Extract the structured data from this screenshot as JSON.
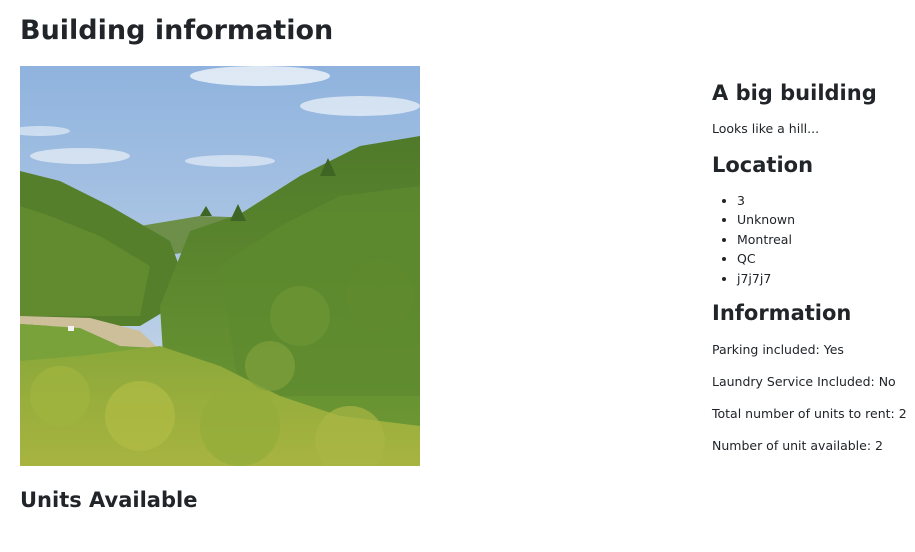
{
  "page": {
    "title": "Building information"
  },
  "photo": {
    "subject": "green forested hillside valley under a light blue sky"
  },
  "building": {
    "name": "A big building",
    "description": "Looks like a hill..."
  },
  "location": {
    "heading": "Location",
    "items": [
      "3",
      "Unknown",
      "Montreal",
      "QC",
      "j7j7j7"
    ]
  },
  "information": {
    "heading": "Information",
    "parking": "Parking included: Yes",
    "laundry": "Laundry Service Included: No",
    "total_units": "Total number of units to rent: 2",
    "available_units": "Number of unit available: 2"
  },
  "units": {
    "heading": "Units Available"
  }
}
